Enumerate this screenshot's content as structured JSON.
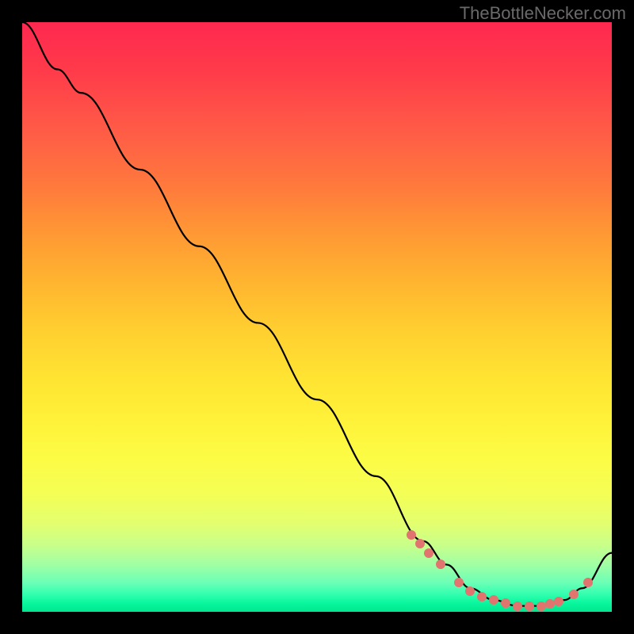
{
  "watermark": "TheBottleNecker.com",
  "chart_data": {
    "type": "line",
    "title": "",
    "xlabel": "",
    "ylabel": "",
    "xlim": [
      0,
      100
    ],
    "ylim": [
      0,
      100
    ],
    "series": [
      {
        "name": "curve",
        "x": [
          0,
          6,
          10,
          20,
          30,
          40,
          50,
          60,
          68,
          72,
          76,
          80,
          84,
          88,
          92,
          95,
          100
        ],
        "y": [
          100,
          92,
          88,
          75,
          62,
          49,
          36,
          23,
          12,
          8,
          4,
          2,
          1,
          1,
          2,
          4,
          10
        ]
      }
    ],
    "markers": {
      "name": "highlight-dots",
      "x": [
        66,
        67.5,
        69,
        71,
        74,
        76,
        78,
        80,
        82,
        84,
        86,
        88,
        89.5,
        91,
        93.5,
        96
      ],
      "y": [
        13,
        11.5,
        10,
        8,
        5,
        3.5,
        2.5,
        2,
        1.5,
        1,
        1,
        1,
        1.3,
        1.8,
        3,
        5
      ]
    },
    "background": "vertical-gradient red→orange→yellow→green",
    "grid": false,
    "legend": false
  }
}
